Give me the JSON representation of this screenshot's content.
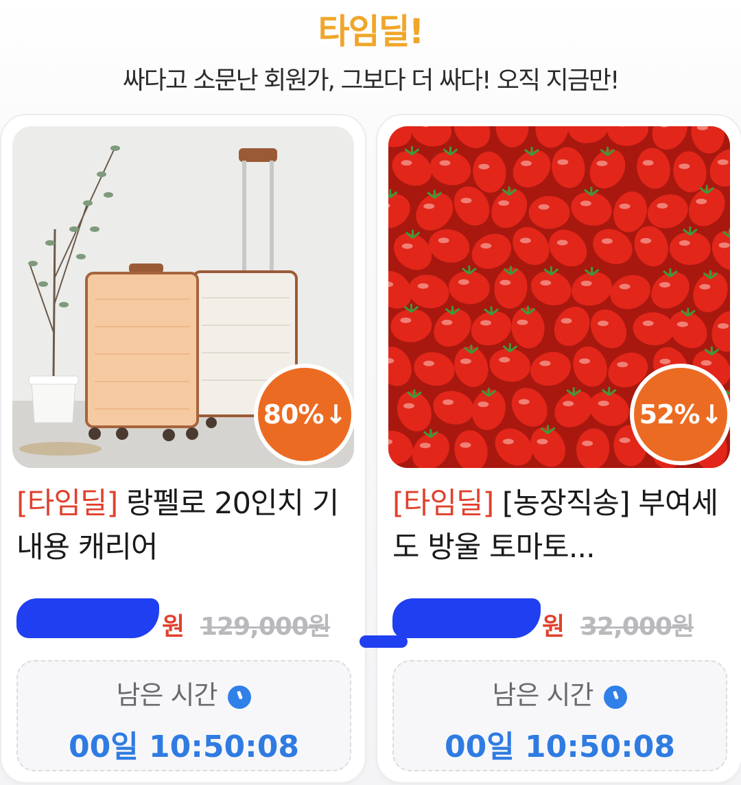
{
  "header": {
    "title": "타임딜!",
    "subtitle": "싸다고 소문난 회원가, 그보다 더 싸다! 오직 지금만!",
    "title_color": "#f0a62a"
  },
  "products": [
    {
      "image_icon": "suitcase-photo",
      "discount": "80%",
      "discount_arrow": "↓",
      "tag": "[타임딜]",
      "name": " 랑펠로 20인치 기내용 캐리어",
      "price_suffix": "원",
      "original_price": "129,000원",
      "timer_label": "남은 시간",
      "timer_value": "00일 10:50:08"
    },
    {
      "image_icon": "cherry-tomato-photo",
      "discount": "52%",
      "discount_arrow": "↓",
      "tag": "[타임딜]",
      "name": " [농장직송] 부여세도 방울 토마토...",
      "price_suffix": "원",
      "original_price": "32,000원",
      "timer_label": "남은 시간",
      "timer_value": "00일 10:50:08"
    }
  ],
  "colors": {
    "accent_red": "#e0412d",
    "badge_orange": "#ec6b22",
    "timer_blue": "#2f7be2",
    "redaction_blue": "#1f3ff0"
  }
}
